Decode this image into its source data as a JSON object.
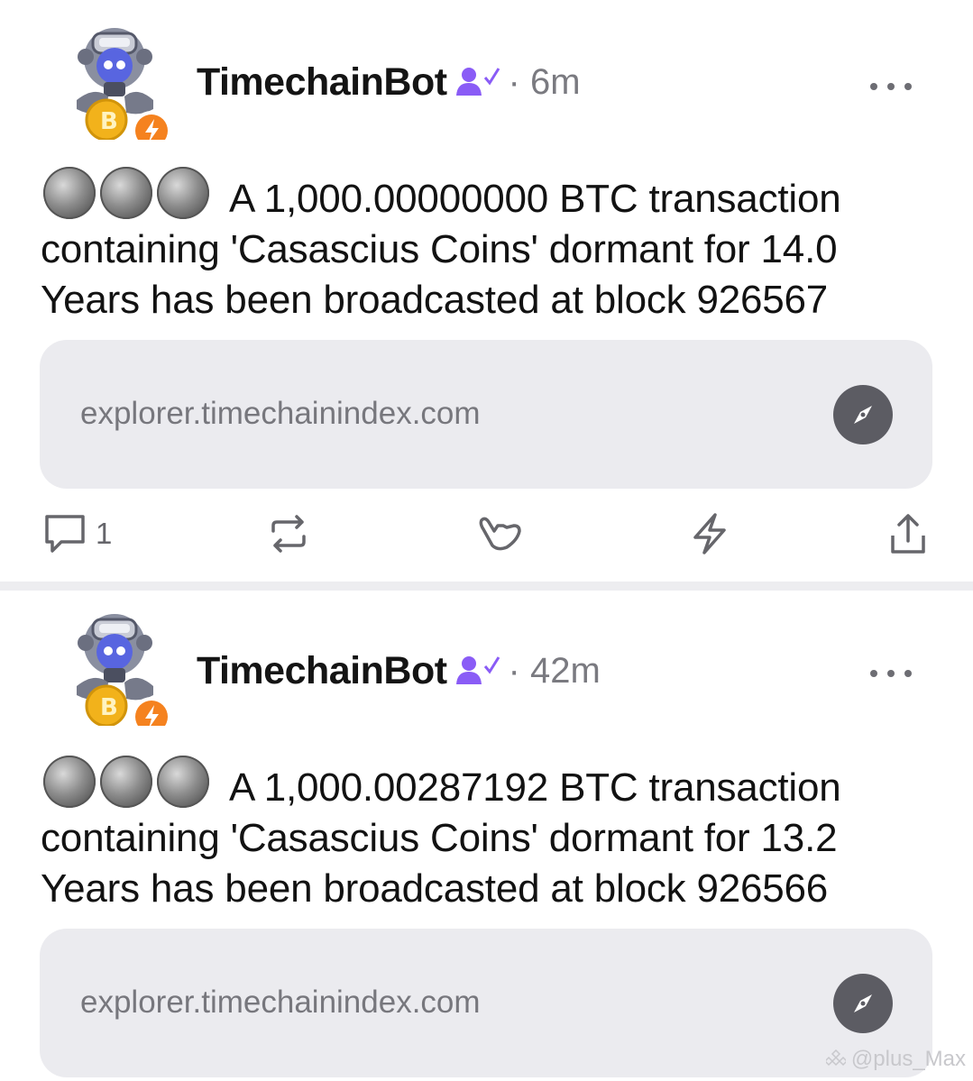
{
  "posts": [
    {
      "username": "TimechainBot",
      "timestamp": "· 6m",
      "text": "A 1,000.00000000 BTC transaction containing 'Casascius Coins' dormant for 14.0 Years has been broadcasted at block 926567",
      "link": "explorer.timechainindex.com",
      "reply_count": "1"
    },
    {
      "username": "TimechainBot",
      "timestamp": "· 42m",
      "text": "A 1,000.00287192 BTC transaction containing 'Casascius Coins' dormant for 13.2 Years has been broadcasted at block 926566",
      "link": "explorer.timechainindex.com"
    }
  ],
  "watermark": "@plus_Max",
  "colors": {
    "verified_purple": "#8a5cf6",
    "zap_orange": "#f5821f",
    "bitcoin_gold": "#f2b21b",
    "card_background": "#ebebef",
    "muted_text": "#7a7a80"
  },
  "icons": [
    "robot-avatar",
    "zap-badge-icon",
    "verified-user-icon",
    "more-icon",
    "coin-emoji",
    "compass-icon",
    "reply-icon",
    "repost-icon",
    "shaka-reaction-icon",
    "zap-icon",
    "share-icon"
  ]
}
